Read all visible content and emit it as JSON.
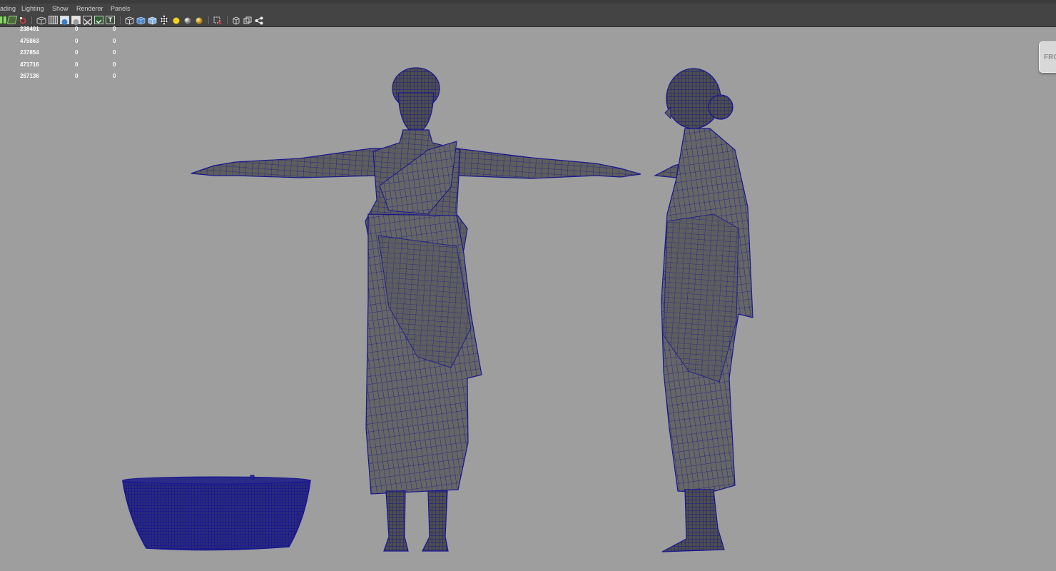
{
  "menubar": {
    "items": [
      "ading",
      "Lighting",
      "Show",
      "Renderer",
      "Panels"
    ]
  },
  "toolbar": {
    "icons": [
      "isolate-icon",
      "camera-snap-icon",
      "bookmark-icon",
      "wireframe-icon",
      "grid-icon",
      "smooth-shade-icon",
      "flat-shade-icon",
      "texture-icon",
      "xray-icon",
      "resolution-gate-icon",
      "text-icon",
      "wire-cube-icon",
      "shaded-cube-icon",
      "textured-cube-icon",
      "checker-icon",
      "default-light-icon",
      "all-lights-icon",
      "flat-light-icon",
      "select-highlight-icon",
      "frame-selection-icon",
      "frame-all-icon",
      "graph-nodes-icon"
    ]
  },
  "hud": {
    "rows": [
      [
        "238401",
        "0",
        "0"
      ],
      [
        "475863",
        "0",
        "0"
      ],
      [
        "237854",
        "0",
        "0"
      ],
      [
        "471716",
        "0",
        "0"
      ],
      [
        "267136",
        "0",
        "0"
      ]
    ]
  },
  "viewport": {
    "camera_label": "FRO",
    "wire_color": "#17178e",
    "mesh_fill": "#5e5e5e",
    "background": "#9e9e9e"
  }
}
